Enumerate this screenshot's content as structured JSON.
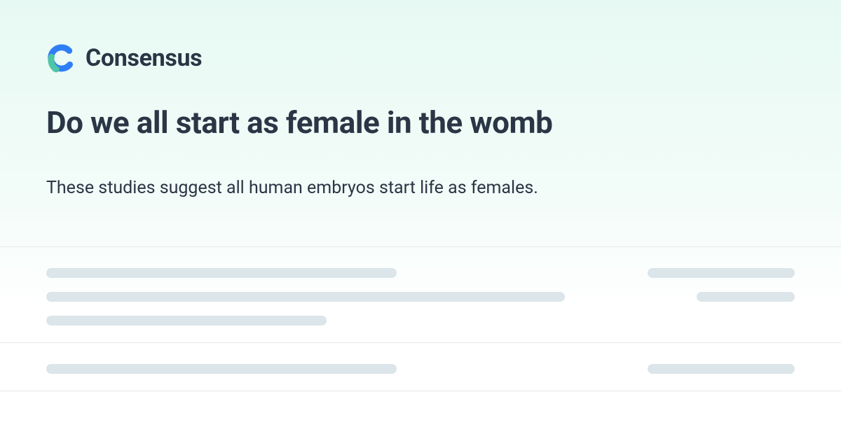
{
  "brand": {
    "name": "Consensus",
    "colors": {
      "blue": "#2f7ef6",
      "teal": "#4ec6a5"
    }
  },
  "page": {
    "title": "Do we all start as female in the womb",
    "summary": "These studies suggest all human embryos start life as females."
  }
}
